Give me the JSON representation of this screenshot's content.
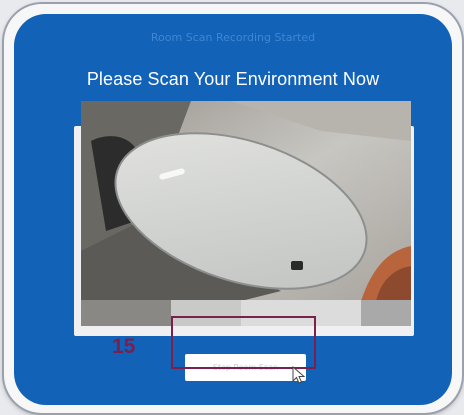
{
  "header": {
    "status_text": "Room Scan Recording Started",
    "title": "Please Scan Your Environment Now"
  },
  "scan": {
    "countdown": "15",
    "stop_button_label": "Stop Room Scan"
  },
  "icons": {
    "cursor": "pointer-cursor-icon"
  },
  "colors": {
    "panel_blue": "#1262b8",
    "highlight": "#7b1f4c",
    "frame": "#f7f7f8"
  }
}
